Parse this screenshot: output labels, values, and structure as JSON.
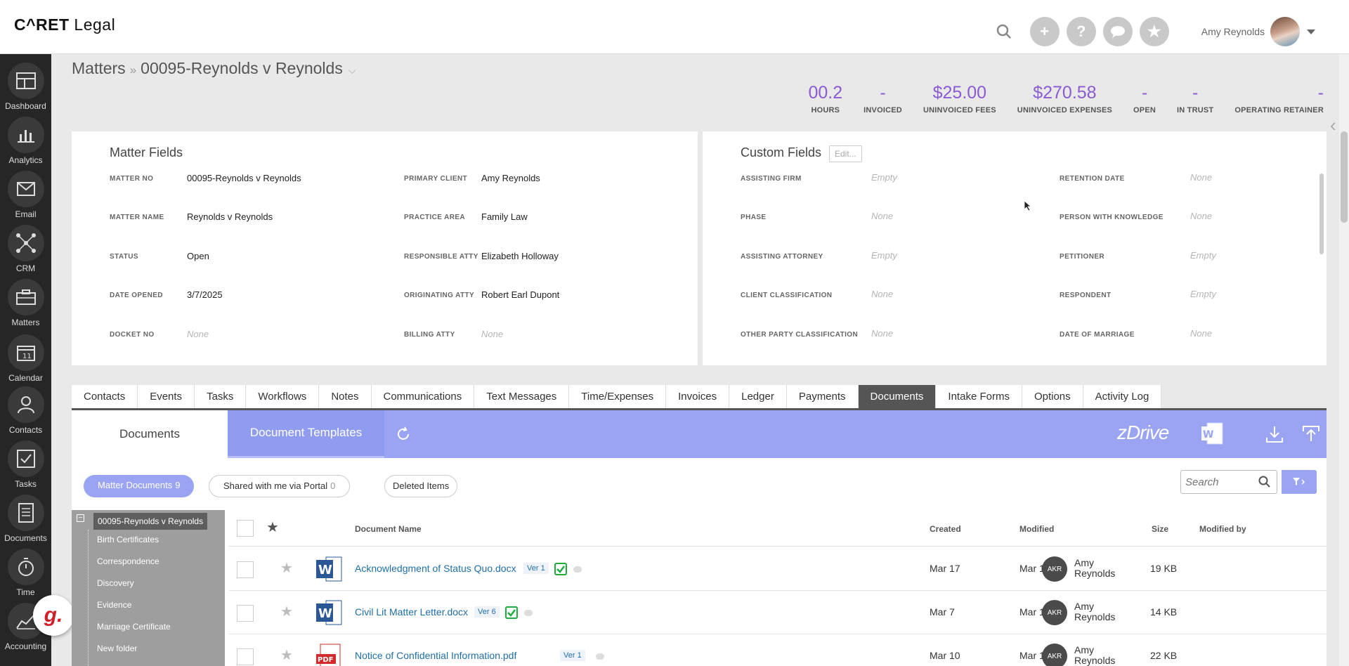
{
  "app": {
    "logo_prefix": "C^RET",
    "logo_suffix": " Legal"
  },
  "topbar": {
    "user_name": "Amy Reynolds"
  },
  "sidebar": {
    "items": [
      {
        "label": "Dashboard",
        "icon": "dashboard-icon"
      },
      {
        "label": "Analytics",
        "icon": "analytics-icon"
      },
      {
        "label": "Email",
        "icon": "email-icon"
      },
      {
        "label": "CRM",
        "icon": "crm-icon"
      },
      {
        "label": "Matters",
        "icon": "briefcase-icon"
      },
      {
        "label": "Calendar",
        "icon": "calendar-icon"
      },
      {
        "label": "Contacts",
        "icon": "contacts-icon"
      },
      {
        "label": "Tasks",
        "icon": "tasks-icon"
      },
      {
        "label": "Documents",
        "icon": "documents-icon"
      },
      {
        "label": "Time",
        "icon": "stopwatch-icon"
      },
      {
        "label": "Accounting",
        "icon": "accounting-icon"
      }
    ],
    "badge": "g."
  },
  "breadcrumb": {
    "root": "Matters",
    "separator": "»",
    "current": "00095-Reynolds v Reynolds"
  },
  "stats": [
    {
      "value": "00.2",
      "label": "HOURS"
    },
    {
      "value": "-",
      "label": "INVOICED"
    },
    {
      "value": "$25.00",
      "label": "UNINVOICED FEES"
    },
    {
      "value": "$270.58",
      "label": "UNINVOICED EXPENSES"
    },
    {
      "value": "-",
      "label": "OPEN"
    },
    {
      "value": "-",
      "label": "IN TRUST"
    },
    {
      "value": "-",
      "label": "OPERATING RETAINER"
    }
  ],
  "matter_fields": {
    "title": "Matter Fields",
    "left": [
      {
        "label": "MATTER NO",
        "value": "00095-Reynolds v Reynolds"
      },
      {
        "label": "MATTER NAME",
        "value": "Reynolds v Reynolds"
      },
      {
        "label": "STATUS",
        "value": "Open"
      },
      {
        "label": "DATE OPENED",
        "value": "3/7/2025"
      },
      {
        "label": "DOCKET NO",
        "value": "None"
      }
    ],
    "right": [
      {
        "label": "PRIMARY CLIENT",
        "value": "Amy Reynolds"
      },
      {
        "label": "PRACTICE AREA",
        "value": "Family Law"
      },
      {
        "label": "RESPONSIBLE ATTY",
        "value": "Elizabeth Holloway"
      },
      {
        "label": "ORIGINATING ATTY",
        "value": "Robert Earl Dupont"
      },
      {
        "label": "BILLING ATTY",
        "value": "None"
      }
    ]
  },
  "custom_fields": {
    "title": "Custom Fields",
    "edit_label": "Edit...",
    "left": [
      {
        "label": "ASSISTING FIRM",
        "value": "Empty"
      },
      {
        "label": "PHASE",
        "value": "None"
      },
      {
        "label": "ASSISTING ATTORNEY",
        "value": "Empty"
      },
      {
        "label": "CLIENT CLASSIFICATION",
        "value": "None"
      },
      {
        "label": "OTHER PARTY CLASSIFICATION",
        "value": "None"
      }
    ],
    "right": [
      {
        "label": "RETENTION DATE",
        "value": "None"
      },
      {
        "label": "PERSON WITH KNOWLEDGE",
        "value": "None"
      },
      {
        "label": "PETITIONER",
        "value": "Empty"
      },
      {
        "label": "RESPONDENT",
        "value": "Empty"
      },
      {
        "label": "DATE OF MARRIAGE",
        "value": "None"
      }
    ]
  },
  "tabs": [
    "Contacts",
    "Events",
    "Tasks",
    "Workflows",
    "Notes",
    "Communications",
    "Text Messages",
    "Time/Expenses",
    "Invoices",
    "Ledger",
    "Payments",
    "Documents",
    "Intake Forms",
    "Options",
    "Activity Log"
  ],
  "active_tab": "Documents",
  "documents": {
    "tab_documents": "Documents",
    "tab_templates": "Document Templates",
    "brand": "zDrive",
    "filters": [
      {
        "label": "Matter Documents",
        "count": "9"
      },
      {
        "label": "Shared with me via Portal",
        "count": "0"
      },
      {
        "label": "Deleted Items",
        "count": ""
      }
    ],
    "search_placeholder": "Search",
    "tree": {
      "root": "00095-Reynolds v Reynolds",
      "folders": [
        "Birth Certificates",
        "Correspondence",
        "Discovery",
        "Evidence",
        "Marriage Certificate",
        "New folder"
      ]
    },
    "columns": [
      "Document Name",
      "Created",
      "Modified",
      "Size",
      "Modified by"
    ],
    "rows": [
      {
        "name": "Acknowledgment of Status Quo.docx",
        "type": "word-icon",
        "version": "Ver 1",
        "created": "Mar 17",
        "modified": "Mar 17",
        "size": "19 KB",
        "initials": "AKR",
        "modified_by": "Amy Reynolds"
      },
      {
        "name": "Civil Lit Matter Letter.docx",
        "type": "word-icon",
        "version": "Ver 6",
        "created": "Mar 7",
        "modified": "Mar 17",
        "size": "14 KB",
        "initials": "AKR",
        "modified_by": "Amy Reynolds"
      },
      {
        "name": "Notice of Confidential Information.pdf",
        "type": "pdf-icon",
        "version": "Ver 1",
        "created": "Mar 10",
        "modified": "Mar 10",
        "size": "22 KB",
        "initials": "AKR",
        "modified_by": "Amy Reynolds"
      }
    ]
  },
  "colors": {
    "accent": "#9aa4f2",
    "stat_purple": "#8b5bd1",
    "link": "#1f6fa5",
    "sidebar": "#262626"
  }
}
